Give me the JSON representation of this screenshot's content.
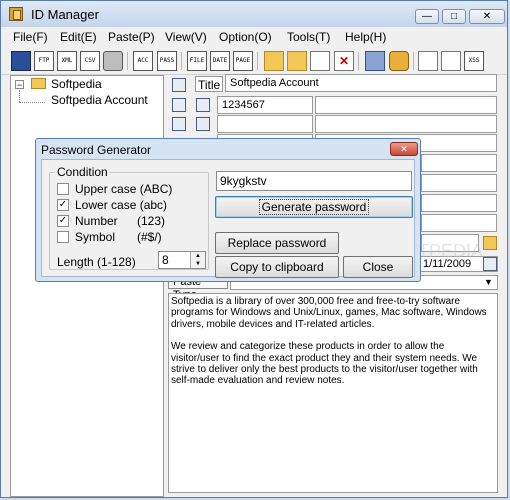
{
  "window": {
    "title": "ID Manager"
  },
  "menubar": [
    "File(F)",
    "Edit(E)",
    "Paste(P)",
    "View(V)",
    "Option(O)",
    "Tools(T)",
    "Help(H)"
  ],
  "toolbar": {
    "text_buttons": [
      "FTP",
      "XML",
      "CSV",
      "ACC",
      "PASS",
      "FILE",
      "DATE",
      "PAGE",
      "XSS"
    ]
  },
  "tree": {
    "root": "Softpedia",
    "child": "Softpedia Account"
  },
  "detail": {
    "title_tab": "Title",
    "title_value": "Softpedia Account",
    "field2_value": "1234567",
    "date_value": "1/11/2009",
    "paste_type": "Paste Type"
  },
  "notes": {
    "paragraph1": "Softpedia is a library of over 300,000 free and free-to-try software programs for Windows and Unix/Linux, games, Mac software, Windows drivers, mobile devices and IT-related articles.",
    "paragraph2": "We review and categorize these products in order to allow the visitor/user to find the exact product they and their system needs. We strive to deliver only the best products to the visitor/user together with self-made evaluation and review notes."
  },
  "dialog": {
    "title": "Password Generator",
    "group_title": "Condition",
    "options": [
      {
        "label": "Upper case (ABC)",
        "checked": false
      },
      {
        "label": "Lower case (abc)",
        "checked": true
      },
      {
        "label": "Number",
        "extra": "(123)",
        "checked": true
      },
      {
        "label": "Symbol",
        "extra": "(#$/)",
        "checked": false
      }
    ],
    "length_label": "Length (1-128)",
    "length_value": "8",
    "generated_password": "9kygkstv",
    "generate_button": "Generate password",
    "replace_button": "Replace password",
    "copy_button": "Copy to clipboard",
    "close_button": "Close"
  },
  "watermark": "SOFTPEDIA"
}
